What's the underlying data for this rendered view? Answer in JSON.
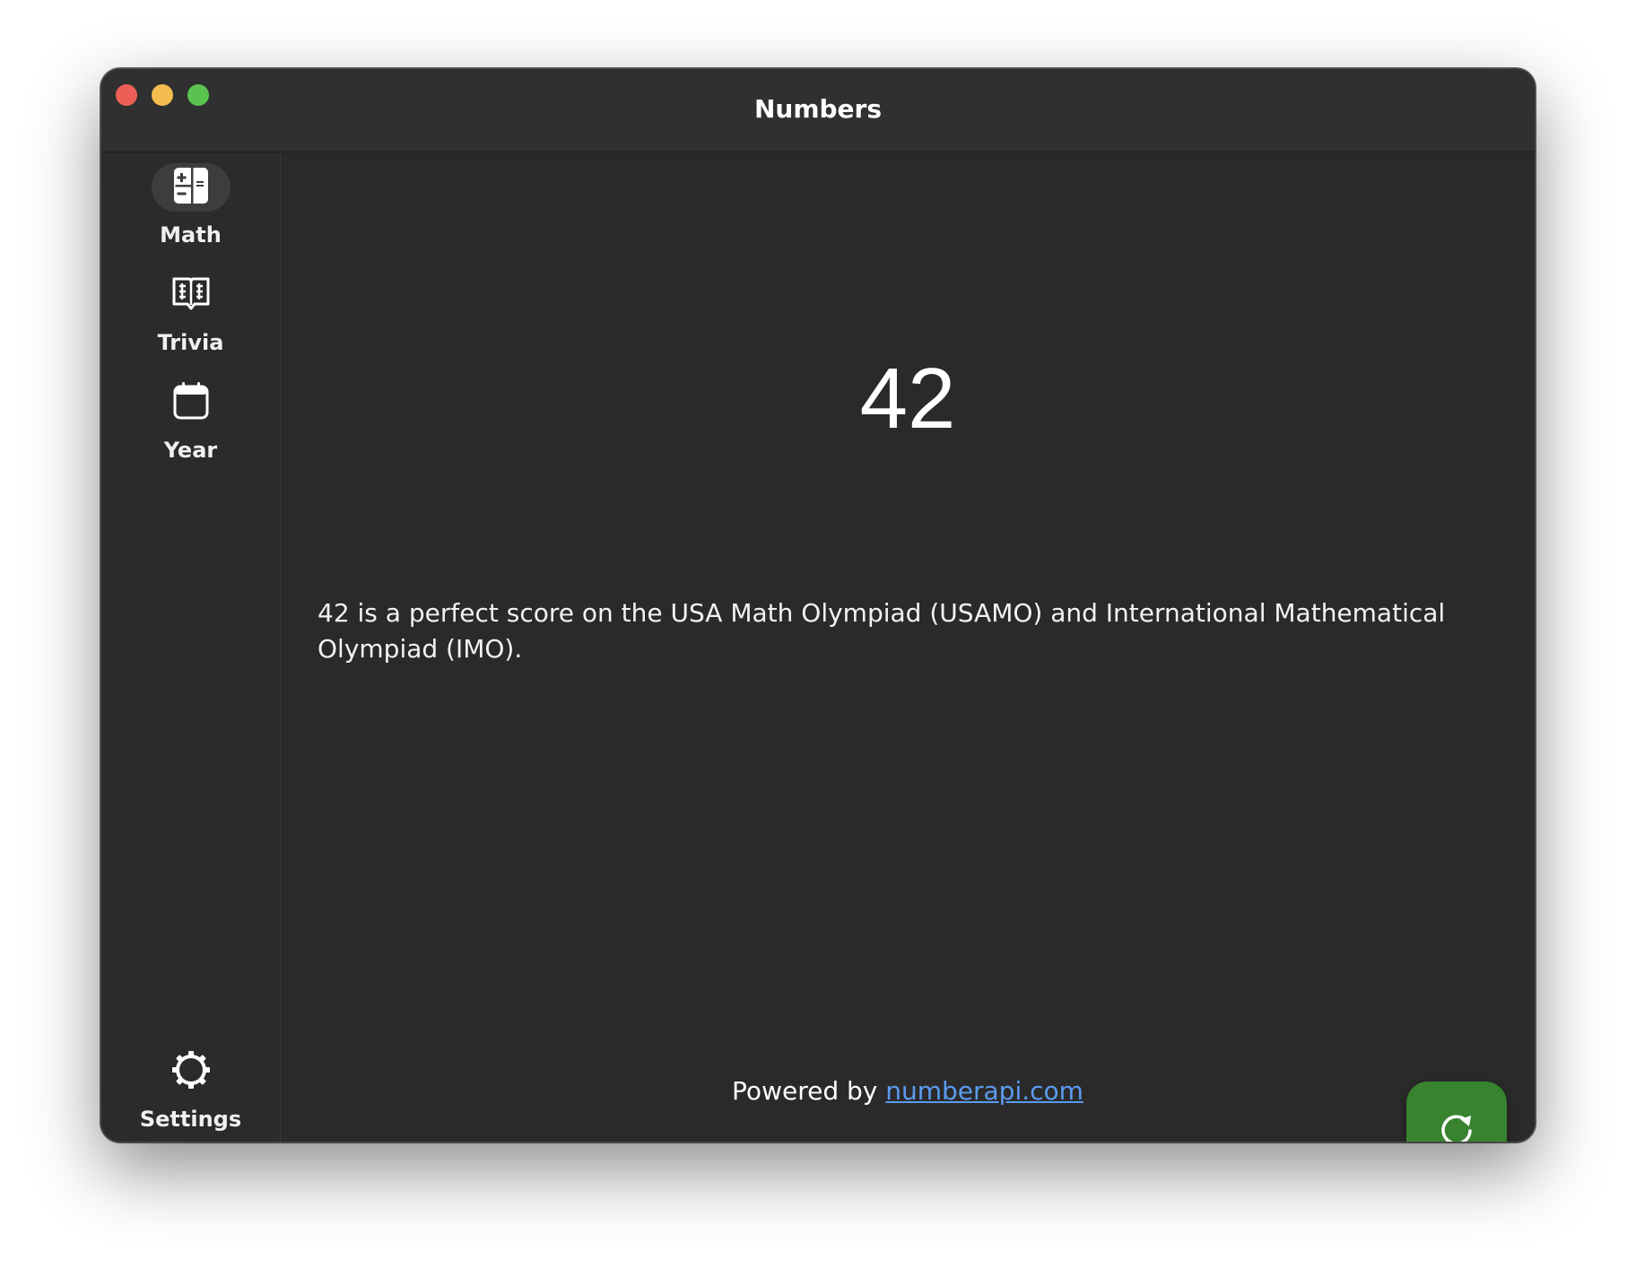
{
  "window": {
    "title": "Numbers"
  },
  "sidebar": {
    "items": [
      {
        "label": "Math",
        "icon": "calculator-icon",
        "active": true
      },
      {
        "label": "Trivia",
        "icon": "book-icon",
        "active": false
      },
      {
        "label": "Year",
        "icon": "calendar-icon",
        "active": false
      }
    ],
    "settings": {
      "label": "Settings",
      "icon": "gear-icon"
    }
  },
  "main": {
    "number": "42",
    "fact": "42 is a perfect score on the USA Math Olympiad (USAMO) and International Mathematical Olympiad (IMO).",
    "footer_prefix": "Powered by ",
    "footer_link": "numberapi.com",
    "refresh_icon": "refresh-icon"
  },
  "colors": {
    "accent": "#38832f",
    "link": "#5b9bf0",
    "background": "#2a2a2a"
  }
}
